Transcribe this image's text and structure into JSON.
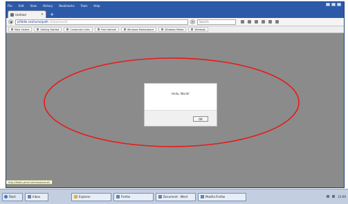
{
  "browser": {
    "menu": [
      "File",
      "Edit",
      "View",
      "History",
      "Bookmarks",
      "Tools",
      "Help"
    ],
    "tab": {
      "title": "Untitled",
      "close": "×"
    },
    "new_tab": "+",
    "nav": {
      "back": "◀",
      "reload": "⟳"
    },
    "url": {
      "domain": "jsfiddle.net/some/path",
      "path": "/show/result/"
    },
    "search_placeholder": "Search",
    "bookmarks": [
      "Most Visited",
      "Getting Started",
      "Customize Links",
      "Free Hotmail",
      "Windows Marketplace",
      "Windows Media",
      "Windows"
    ],
    "status_url": "http://fiddle.jshell.net/show/result/"
  },
  "dialog": {
    "message": "Hello, World!",
    "ok_label": "OK"
  },
  "annotation": {
    "color": "#e81818"
  },
  "taskbar": {
    "start_label": "Start",
    "items": [
      {
        "label": "Inbox"
      },
      {
        "label": "Explorer",
        "yellow": true
      },
      {
        "label": "Firefox"
      },
      {
        "label": "Document - Word"
      },
      {
        "label": "Mozilla Firefox"
      }
    ],
    "time": "12:00"
  }
}
